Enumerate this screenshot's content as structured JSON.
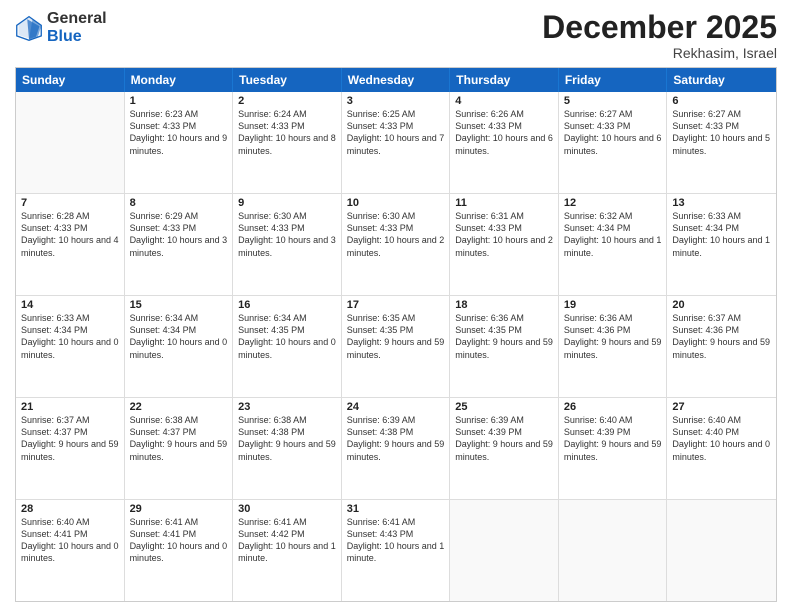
{
  "header": {
    "logo_general": "General",
    "logo_blue": "Blue",
    "month_title": "December 2025",
    "location": "Rekhasim, Israel"
  },
  "days_of_week": [
    "Sunday",
    "Monday",
    "Tuesday",
    "Wednesday",
    "Thursday",
    "Friday",
    "Saturday"
  ],
  "weeks": [
    [
      {
        "day": "",
        "empty": true
      },
      {
        "day": "1",
        "sunrise": "Sunrise: 6:23 AM",
        "sunset": "Sunset: 4:33 PM",
        "daylight": "Daylight: 10 hours and 9 minutes."
      },
      {
        "day": "2",
        "sunrise": "Sunrise: 6:24 AM",
        "sunset": "Sunset: 4:33 PM",
        "daylight": "Daylight: 10 hours and 8 minutes."
      },
      {
        "day": "3",
        "sunrise": "Sunrise: 6:25 AM",
        "sunset": "Sunset: 4:33 PM",
        "daylight": "Daylight: 10 hours and 7 minutes."
      },
      {
        "day": "4",
        "sunrise": "Sunrise: 6:26 AM",
        "sunset": "Sunset: 4:33 PM",
        "daylight": "Daylight: 10 hours and 6 minutes."
      },
      {
        "day": "5",
        "sunrise": "Sunrise: 6:27 AM",
        "sunset": "Sunset: 4:33 PM",
        "daylight": "Daylight: 10 hours and 6 minutes."
      },
      {
        "day": "6",
        "sunrise": "Sunrise: 6:27 AM",
        "sunset": "Sunset: 4:33 PM",
        "daylight": "Daylight: 10 hours and 5 minutes."
      }
    ],
    [
      {
        "day": "7",
        "sunrise": "Sunrise: 6:28 AM",
        "sunset": "Sunset: 4:33 PM",
        "daylight": "Daylight: 10 hours and 4 minutes."
      },
      {
        "day": "8",
        "sunrise": "Sunrise: 6:29 AM",
        "sunset": "Sunset: 4:33 PM",
        "daylight": "Daylight: 10 hours and 3 minutes."
      },
      {
        "day": "9",
        "sunrise": "Sunrise: 6:30 AM",
        "sunset": "Sunset: 4:33 PM",
        "daylight": "Daylight: 10 hours and 3 minutes."
      },
      {
        "day": "10",
        "sunrise": "Sunrise: 6:30 AM",
        "sunset": "Sunset: 4:33 PM",
        "daylight": "Daylight: 10 hours and 2 minutes."
      },
      {
        "day": "11",
        "sunrise": "Sunrise: 6:31 AM",
        "sunset": "Sunset: 4:33 PM",
        "daylight": "Daylight: 10 hours and 2 minutes."
      },
      {
        "day": "12",
        "sunrise": "Sunrise: 6:32 AM",
        "sunset": "Sunset: 4:34 PM",
        "daylight": "Daylight: 10 hours and 1 minute."
      },
      {
        "day": "13",
        "sunrise": "Sunrise: 6:33 AM",
        "sunset": "Sunset: 4:34 PM",
        "daylight": "Daylight: 10 hours and 1 minute."
      }
    ],
    [
      {
        "day": "14",
        "sunrise": "Sunrise: 6:33 AM",
        "sunset": "Sunset: 4:34 PM",
        "daylight": "Daylight: 10 hours and 0 minutes."
      },
      {
        "day": "15",
        "sunrise": "Sunrise: 6:34 AM",
        "sunset": "Sunset: 4:34 PM",
        "daylight": "Daylight: 10 hours and 0 minutes."
      },
      {
        "day": "16",
        "sunrise": "Sunrise: 6:34 AM",
        "sunset": "Sunset: 4:35 PM",
        "daylight": "Daylight: 10 hours and 0 minutes."
      },
      {
        "day": "17",
        "sunrise": "Sunrise: 6:35 AM",
        "sunset": "Sunset: 4:35 PM",
        "daylight": "Daylight: 9 hours and 59 minutes."
      },
      {
        "day": "18",
        "sunrise": "Sunrise: 6:36 AM",
        "sunset": "Sunset: 4:35 PM",
        "daylight": "Daylight: 9 hours and 59 minutes."
      },
      {
        "day": "19",
        "sunrise": "Sunrise: 6:36 AM",
        "sunset": "Sunset: 4:36 PM",
        "daylight": "Daylight: 9 hours and 59 minutes."
      },
      {
        "day": "20",
        "sunrise": "Sunrise: 6:37 AM",
        "sunset": "Sunset: 4:36 PM",
        "daylight": "Daylight: 9 hours and 59 minutes."
      }
    ],
    [
      {
        "day": "21",
        "sunrise": "Sunrise: 6:37 AM",
        "sunset": "Sunset: 4:37 PM",
        "daylight": "Daylight: 9 hours and 59 minutes."
      },
      {
        "day": "22",
        "sunrise": "Sunrise: 6:38 AM",
        "sunset": "Sunset: 4:37 PM",
        "daylight": "Daylight: 9 hours and 59 minutes."
      },
      {
        "day": "23",
        "sunrise": "Sunrise: 6:38 AM",
        "sunset": "Sunset: 4:38 PM",
        "daylight": "Daylight: 9 hours and 59 minutes."
      },
      {
        "day": "24",
        "sunrise": "Sunrise: 6:39 AM",
        "sunset": "Sunset: 4:38 PM",
        "daylight": "Daylight: 9 hours and 59 minutes."
      },
      {
        "day": "25",
        "sunrise": "Sunrise: 6:39 AM",
        "sunset": "Sunset: 4:39 PM",
        "daylight": "Daylight: 9 hours and 59 minutes."
      },
      {
        "day": "26",
        "sunrise": "Sunrise: 6:40 AM",
        "sunset": "Sunset: 4:39 PM",
        "daylight": "Daylight: 9 hours and 59 minutes."
      },
      {
        "day": "27",
        "sunrise": "Sunrise: 6:40 AM",
        "sunset": "Sunset: 4:40 PM",
        "daylight": "Daylight: 10 hours and 0 minutes."
      }
    ],
    [
      {
        "day": "28",
        "sunrise": "Sunrise: 6:40 AM",
        "sunset": "Sunset: 4:41 PM",
        "daylight": "Daylight: 10 hours and 0 minutes."
      },
      {
        "day": "29",
        "sunrise": "Sunrise: 6:41 AM",
        "sunset": "Sunset: 4:41 PM",
        "daylight": "Daylight: 10 hours and 0 minutes."
      },
      {
        "day": "30",
        "sunrise": "Sunrise: 6:41 AM",
        "sunset": "Sunset: 4:42 PM",
        "daylight": "Daylight: 10 hours and 1 minute."
      },
      {
        "day": "31",
        "sunrise": "Sunrise: 6:41 AM",
        "sunset": "Sunset: 4:43 PM",
        "daylight": "Daylight: 10 hours and 1 minute."
      },
      {
        "day": "",
        "empty": true
      },
      {
        "day": "",
        "empty": true
      },
      {
        "day": "",
        "empty": true
      }
    ]
  ]
}
